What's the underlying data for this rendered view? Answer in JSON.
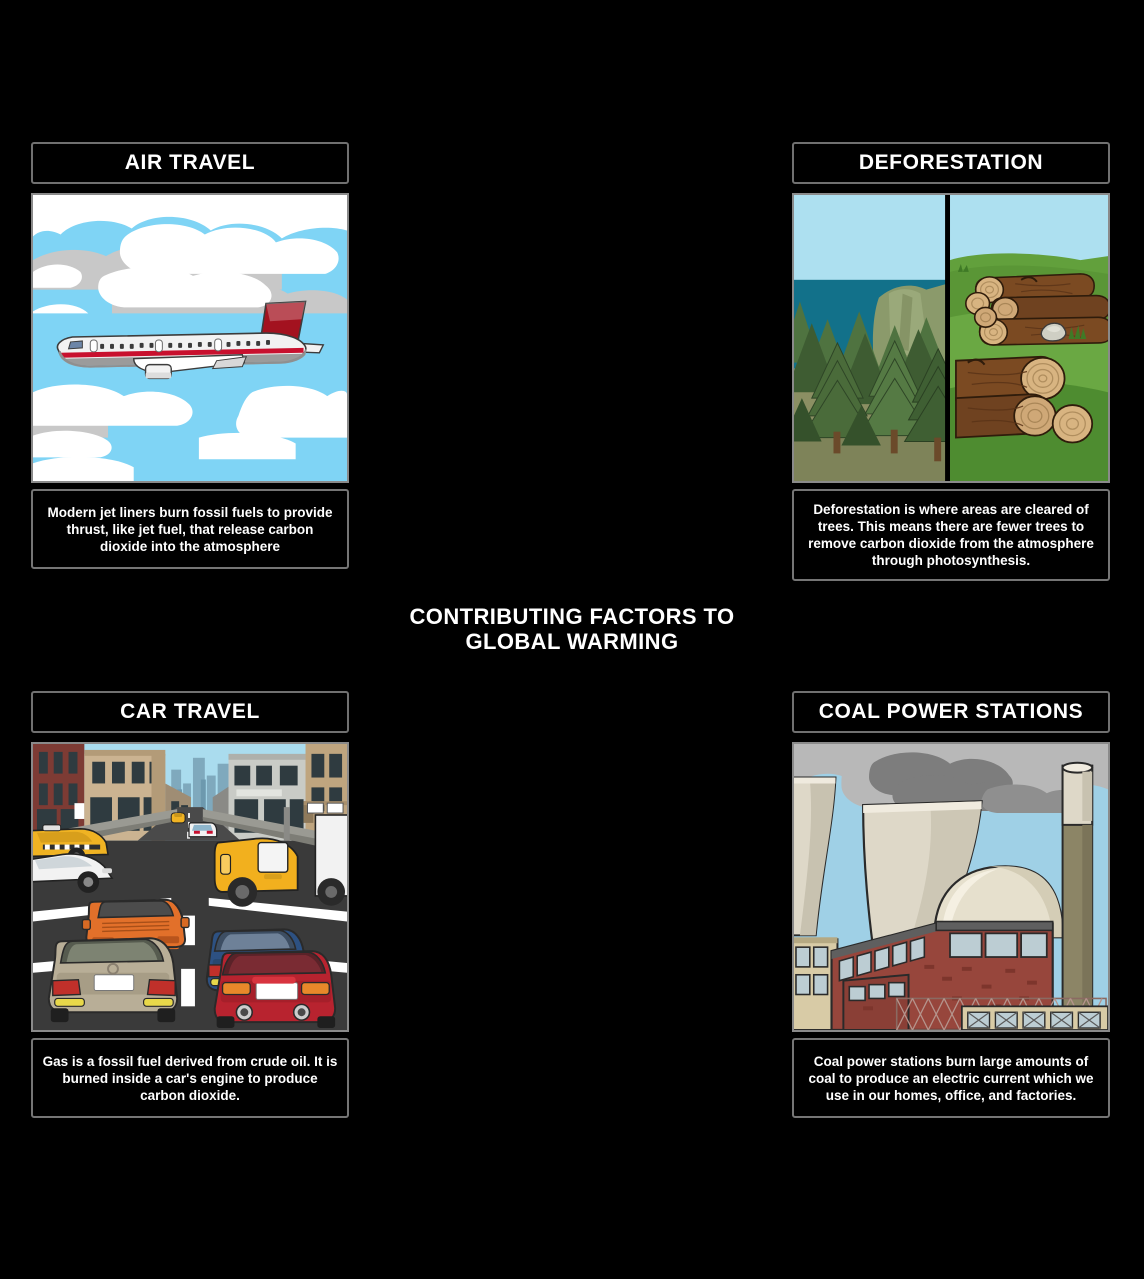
{
  "board": {
    "background_color": "#000000",
    "heading": "CONTRIBUTING FACTORS TO GLOBAL WARMING",
    "text_color": "#ffffff",
    "frame_border_color": "#8a8a8a"
  },
  "cells": [
    {
      "id": "air-travel",
      "title": "AIR TRAVEL",
      "caption": "Modern jet liners burn fossil fuels to provide thrust, like jet fuel, that release carbon dioxide into the atmosphere",
      "scene": "airplane-in-sky",
      "colors": {
        "sky": "#7fd4f5",
        "cloud": "#ffffff",
        "cloud_shadow": "#c8c8c8",
        "fuselage": "#f2f2f2",
        "belly": "#9b9b9b",
        "stripe": "#c8102e",
        "tail": "#a3121f",
        "window": "#6d86a8"
      }
    },
    {
      "id": "deforestation",
      "title": "DEFORESTATION",
      "caption": "Deforestation is where areas are cleared of trees. This means there are fewer trees to remove carbon dioxide from the atmosphere through photosynthesis.",
      "scene": "forest-and-cut-logs",
      "colors": {
        "sky": "#ade0f0",
        "water": "#12718a",
        "cliff": "#8b9a6b",
        "tree_dark": "#3e5c32",
        "tree_mid": "#4f7340",
        "tree_light": "#5f8a4c",
        "ground": "#8b8f63",
        "grass": "#62a03c",
        "grass_dark": "#4e8c30",
        "log_bark": "#7b4a22",
        "log_bark_dark": "#5e3617",
        "log_end": "#d8b481",
        "rock": "#cfcfc4",
        "divider": "#000000"
      }
    },
    {
      "id": "car-travel",
      "title": "CAR TRAVEL",
      "caption": "Gas is a fossil fuel derived from crude oil. It is burned inside a car's engine to produce carbon dioxide.",
      "scene": "city-street-traffic",
      "colors": {
        "sky": "#aadcee",
        "skyline": "#7fa9bd",
        "road": "#3a3a3a",
        "road_far": "#4a4a4a",
        "lane_marking": "#ffffff",
        "sidewalk": "#9a9a93",
        "building_brick": "#7d3b34",
        "building_tan": "#cbb391",
        "building_grey": "#c9cbc6",
        "building_beige": "#bfa57f",
        "car_orange": "#e2702a",
        "car_tan": "#b8ae97",
        "car_blue": "#2d5182",
        "car_red": "#b8232f",
        "car_white": "#f2f2f2",
        "taxi_yellow": "#f0b323",
        "truck_yellow": "#f2b01e",
        "window_dark": "#2f3b40"
      }
    },
    {
      "id": "coal-power-stations",
      "title": "COAL POWER STATIONS",
      "caption": "Coal power stations burn large amounts of coal to produce an electric current which we use in our homes, office, and factories.",
      "scene": "coal-power-plant",
      "colors": {
        "sky": "#9fd0e6",
        "smoke_light": "#b8b8b8",
        "smoke_dark": "#7d7d7d",
        "tower": "#ded8c8",
        "tower_shade": "#c8c2b0",
        "dome": "#e6e0cd",
        "stack_top": "#ded8c8",
        "stack_body": "#8c8566",
        "brick": "#97463c",
        "brick_dark": "#7d352c",
        "roof": "#5f5f5f",
        "glass": "#bccdd3",
        "annex": "#d8cba6",
        "fence": "#b5948c"
      }
    }
  ]
}
